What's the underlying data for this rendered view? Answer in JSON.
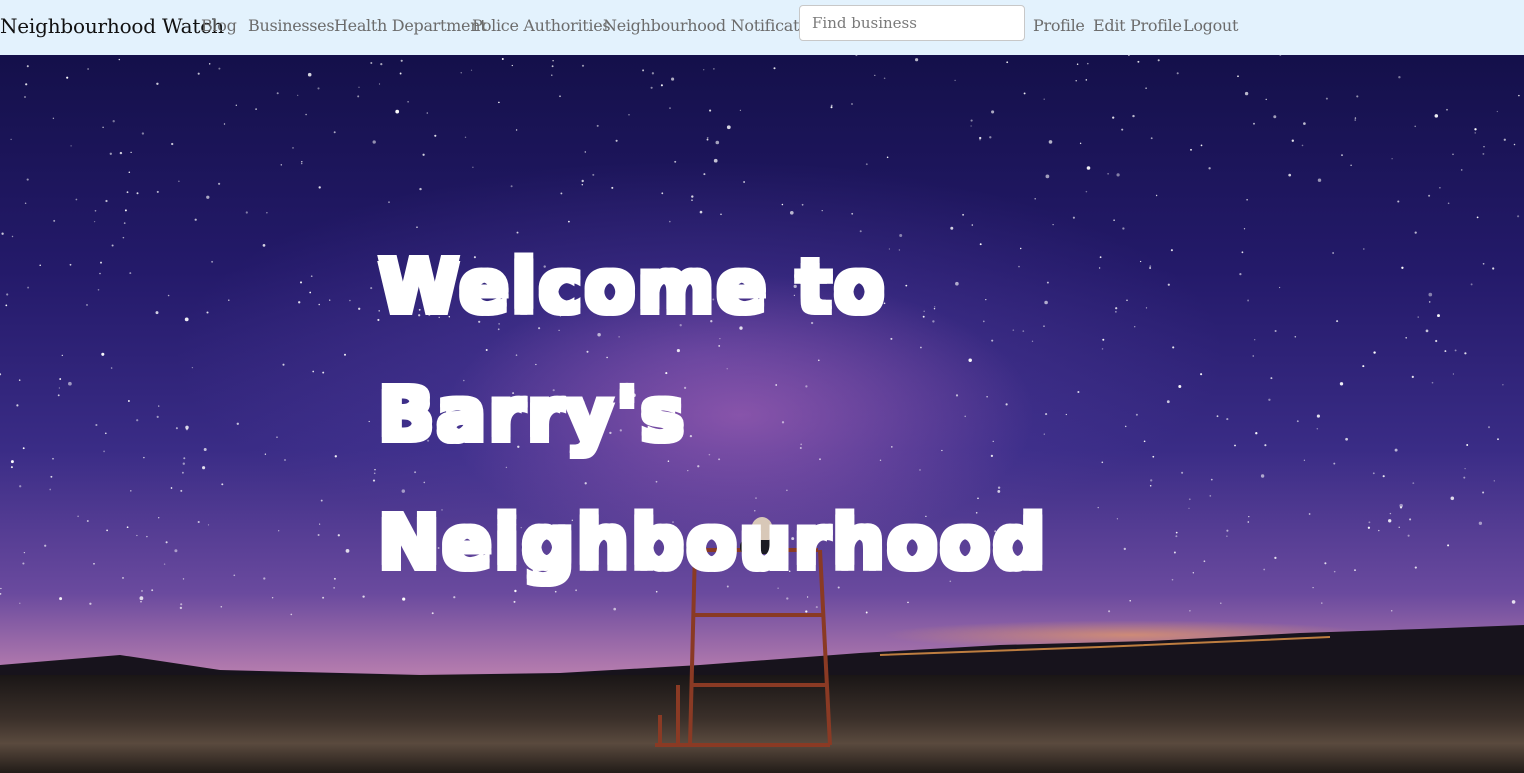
{
  "navbar": {
    "brand": "Neighbourhood Watch",
    "links": [
      {
        "label": "Blog"
      },
      {
        "label": "Businesses"
      },
      {
        "label": "Health Department"
      },
      {
        "label": "Police Authorities"
      },
      {
        "label": "Neighbourhood Notifications"
      }
    ],
    "search": {
      "placeholder": "Find business",
      "value": ""
    },
    "user_links": [
      {
        "label": "Profile"
      },
      {
        "label": "Edit Profile"
      },
      {
        "label": "Logout"
      }
    ]
  },
  "hero": {
    "title_lines": [
      "Welcome to",
      "Barry's",
      "Neighbourhood"
    ]
  },
  "colors": {
    "navbar_bg": "#e3f2fd",
    "nav_link": "#6c6c6c",
    "brand": "#111111",
    "hero_text": "#ffffff"
  }
}
